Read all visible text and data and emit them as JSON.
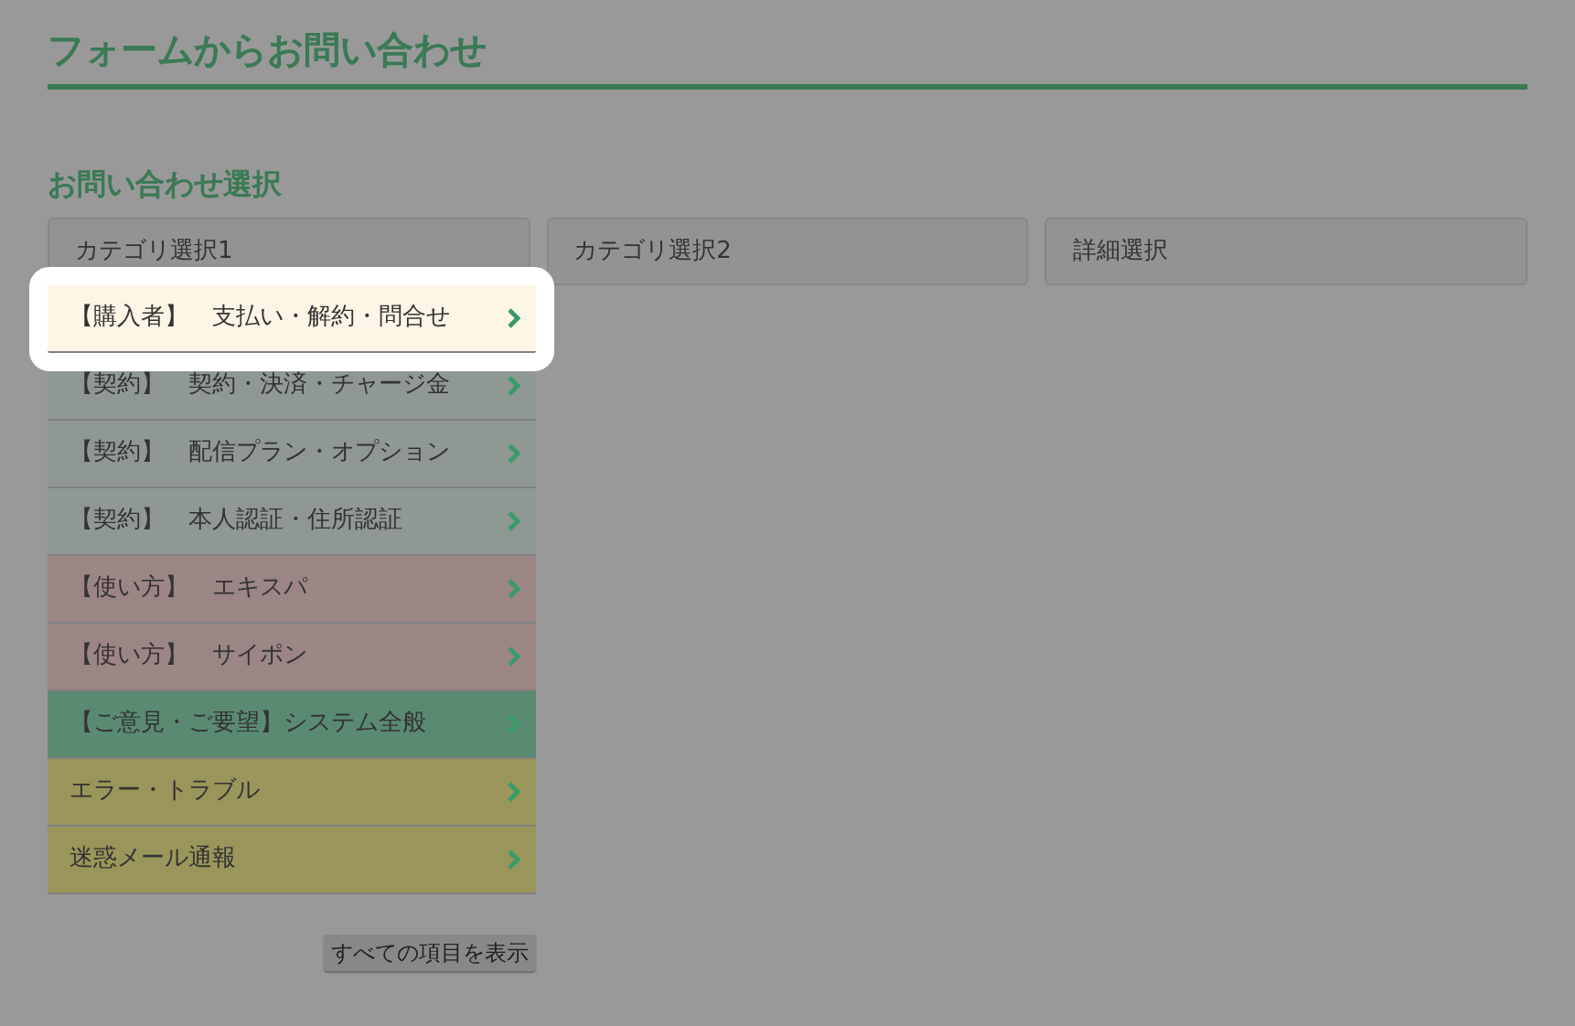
{
  "page_title": "フォームからお問い合わせ",
  "section_title": "お問い合わせ選択",
  "steps": [
    {
      "label": "カテゴリ選択1"
    },
    {
      "label": "カテゴリ選択2"
    },
    {
      "label": "詳細選択"
    }
  ],
  "categories": [
    {
      "label": "【購入者】　支払い・解約・問合せ",
      "color": "#fdf5e6",
      "highlighted": true
    },
    {
      "label": "【契約】　契約・決済・チャージ金",
      "color": "#8f9893",
      "highlighted": false
    },
    {
      "label": "【契約】　配信プラン・オプション",
      "color": "#8f9893",
      "highlighted": false
    },
    {
      "label": "【契約】　本人認証・住所認証",
      "color": "#8f9893",
      "highlighted": false
    },
    {
      "label": "【使い方】　エキスパ",
      "color": "#9c8585",
      "highlighted": false
    },
    {
      "label": "【使い方】　サイポン",
      "color": "#9c8585",
      "highlighted": false
    },
    {
      "label": "【ご意見・ご要望】システム全般",
      "color": "#5a8a72",
      "highlighted": false
    },
    {
      "label": "エラー・トラブル",
      "color": "#9a955a",
      "highlighted": false
    },
    {
      "label": "迷惑メール通報",
      "color": "#9a955a",
      "highlighted": false
    }
  ],
  "show_all_button": "すべての項目を表示"
}
